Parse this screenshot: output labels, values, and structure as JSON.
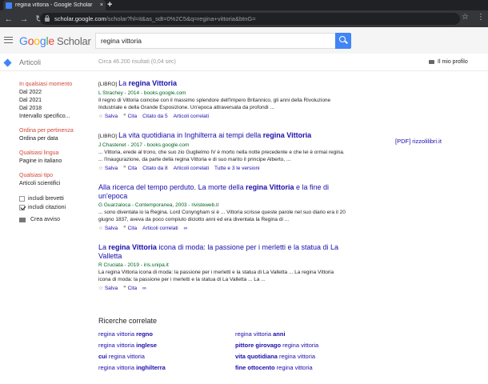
{
  "browser": {
    "tab_title": "regina vittoria - Google Scholar",
    "tab_close": "×",
    "new_tab": "+",
    "url_host": "scholar.google.com",
    "url_rest": "/scholar?hl=it&as_sdt=0%2C5&q=regina+vittoria&btnG=",
    "back": "←",
    "forward": "→",
    "reload": "↻",
    "star": "☆",
    "menu": "⋮"
  },
  "header": {
    "logo_letters": [
      "G",
      "o",
      "o",
      "g",
      "l",
      "e"
    ],
    "logo_suffix": "Scholar",
    "query": "regina vittoria"
  },
  "subhead": {
    "section": "Articoli",
    "count": "Circa 46.200 risultati (0,04 sec)",
    "profile": "Il mio profilo"
  },
  "sidebar": {
    "time_title": "In qualsiasi momento",
    "time_items": [
      "Dal 2022",
      "Dal 2021",
      "Dal 2018",
      "Intervallo specifico..."
    ],
    "sort_title": "Ordina per pertinenza",
    "sort_alt": "Ordina per data",
    "lang_title": "Qualsiasi lingua",
    "lang_alt": "Pagine in italiano",
    "type_title": "Qualsiasi tipo",
    "type_alt": "Articoli scientifici",
    "check_patents": "includi brevetti",
    "check_citations": "includi citazioni",
    "create_alert": "Crea avviso"
  },
  "results": [
    {
      "tag": "[LIBRO]",
      "title_pre": "La ",
      "title_bold": "regina Vittoria",
      "title_post": "",
      "meta": "L Strachey - 2014 - books.google.com",
      "snippet": "Il regno di Vittoria coincise con il massimo splendore dell'Impero Britannico, gli anni della Rivoluzione Industriale e della Grande Esposizione. Un'epoca attraversata da profondi ...",
      "actions": [
        "Salva",
        "Cita",
        "Citato da 5",
        "Articoli correlati"
      ]
    },
    {
      "tag": "[LIBRO]",
      "title_pre": "La vita quotidiana in Inghilterra ai tempi della ",
      "title_bold": "regina Vittoria",
      "title_post": "",
      "meta": "J Chastenet - 2017 - books.google.com",
      "snippet": "... Vittoria, erede al trono, che suo zio Guglielmo IV è morto nella notte precedente e che lei è ormai regina. ... l'inaugurazione, da parte della regina Vittoria e di suo marito il principe Alberto, ...",
      "actions": [
        "Salva",
        "Cita",
        "Citato da 8",
        "Articoli correlati",
        "Tutte e 3 le versioni"
      ],
      "pdf": "[PDF] rizzolilibri.it"
    },
    {
      "tag": "",
      "title_pre": "Alla ricerca del tempo perduto. La morte della ",
      "title_bold": "regina Vittoria",
      "title_post": " e la fine di un'epoca",
      "meta": "G Guarzaloca - Contemporanea, 2003 - rivisteweb.it",
      "snippet": "... sono diventata io la Regina. Lord Conyngham si è ... Vittoria scrisse queste parole nel suo diario era il 20 giugno 1837, aveva da poco compiuto diciotto anni ed era diventata la Regina di ...",
      "actions": [
        "Salva",
        "Cita",
        "Articoli correlati",
        "∞"
      ]
    },
    {
      "tag": "",
      "title_pre": "La ",
      "title_bold": "regina Vittoria",
      "title_post": " icona di moda: la passione per i merletti e la statua di La Valletta",
      "meta": "R Cruciata - 2019 - iris.unipa.it",
      "snippet": "La regina Vittoria icona di moda: la passione per i merletti e la statua di La Valletta ... La regina Vittoria icona di moda: la passione per i merletti e la statua di La Valletta ... La ...",
      "actions": [
        "Salva",
        "Cita",
        "∞"
      ]
    }
  ],
  "related": {
    "title": "Ricerche correlate",
    "items": [
      {
        "pre": "regina vittoria ",
        "bold": "regno",
        "post": ""
      },
      {
        "pre": "regina vittoria ",
        "bold": "anni",
        "post": ""
      },
      {
        "pre": "regina vittoria ",
        "bold": "inglese",
        "post": ""
      },
      {
        "pre": "",
        "bold": "pittore girovago",
        "post": " regina vittoria"
      },
      {
        "pre": "",
        "bold": "cui",
        "post": " regina vittoria"
      },
      {
        "pre": "",
        "bold": "vita quotidiana",
        "post": " regina vittoria"
      },
      {
        "pre": "regina vittoria ",
        "bold": "inghilterra",
        "post": ""
      },
      {
        "pre": "",
        "bold": "fine ottocento",
        "post": " regina vittoria"
      }
    ]
  },
  "colors": {
    "link": "#1a0dab",
    "meta_green": "#006621",
    "red_label": "#d14836",
    "search_blue": "#4285f4",
    "browser_dark": "#202124"
  }
}
